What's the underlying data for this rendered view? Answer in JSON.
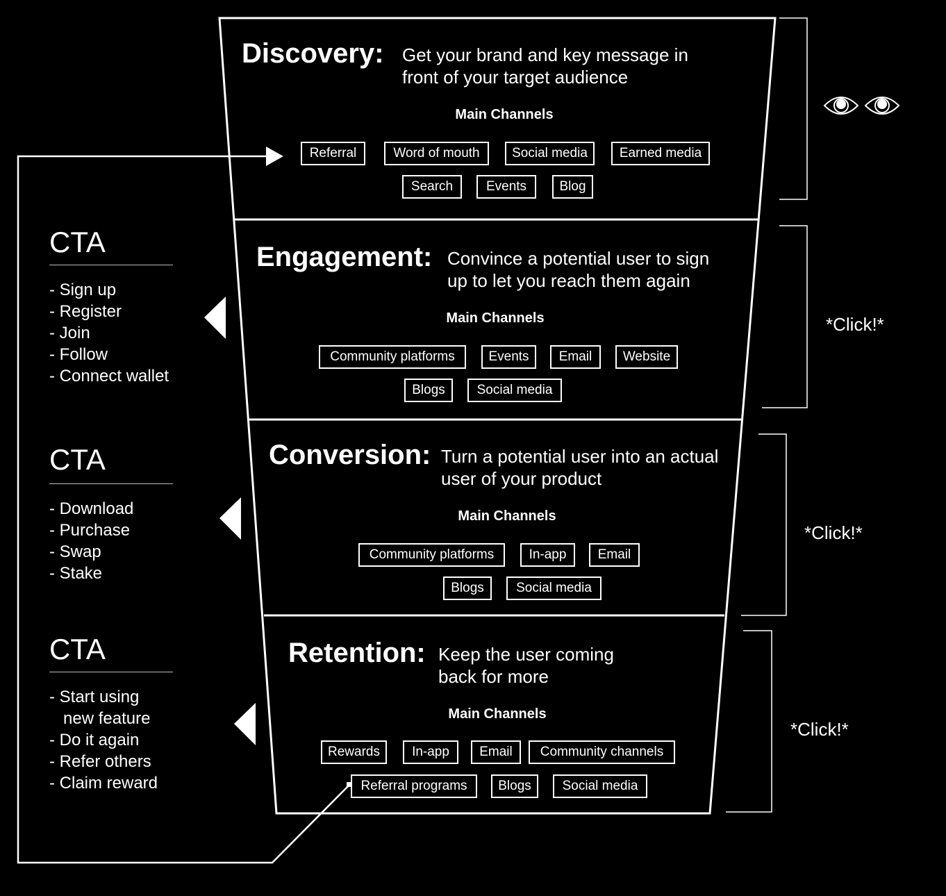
{
  "stages": [
    {
      "title": "Discovery:",
      "desc_lines": [
        "Get your brand and key message in",
        "front of your target audience"
      ],
      "channels_label": "Main Channels",
      "channels": [
        "Referral",
        "Word of mouth",
        "Social media",
        "Earned media",
        "Search",
        "Events",
        "Blog"
      ]
    },
    {
      "title": "Engagement:",
      "desc_lines": [
        "Convince a potential user to sign",
        "up to let you reach them again"
      ],
      "channels_label": "Main Channels",
      "channels": [
        "Community platforms",
        "Events",
        "Email",
        "Website",
        "Blogs",
        "Social media"
      ]
    },
    {
      "title": "Conversion:",
      "desc_lines": [
        "Turn a potential user into an actual",
        "user of your product"
      ],
      "channels_label": "Main Channels",
      "channels": [
        "Community platforms",
        "In-app",
        "Email",
        "Blogs",
        "Social media"
      ]
    },
    {
      "title": "Retention:",
      "desc_lines": [
        "Keep the user coming",
        "back for more"
      ],
      "channels_label": "Main Channels",
      "channels": [
        "Rewards",
        "In-app",
        "Email",
        "Community channels",
        "Referral programs",
        "Blogs",
        "Social media"
      ]
    }
  ],
  "ctas": [
    {
      "title": "CTA",
      "items": [
        "- Sign up",
        "- Register",
        "- Join",
        "- Follow",
        "- Connect wallet"
      ]
    },
    {
      "title": "CTA",
      "items": [
        "- Download",
        "- Purchase",
        "- Swap",
        "- Stake"
      ]
    },
    {
      "title": "CTA",
      "items": [
        "- Start using",
        "   new feature",
        "- Do it again",
        "- Refer others",
        "- Claim reward"
      ]
    }
  ],
  "side_labels": [
    "*Click!*",
    "*Click!*",
    "*Click!*"
  ],
  "icons": {
    "discovery_side": "eyes-icon",
    "cta_pointer": "triangle-left-icon",
    "loop_arrow": "arrow-right-icon"
  },
  "colors": {
    "background": "#000000",
    "foreground": "#ffffff"
  }
}
